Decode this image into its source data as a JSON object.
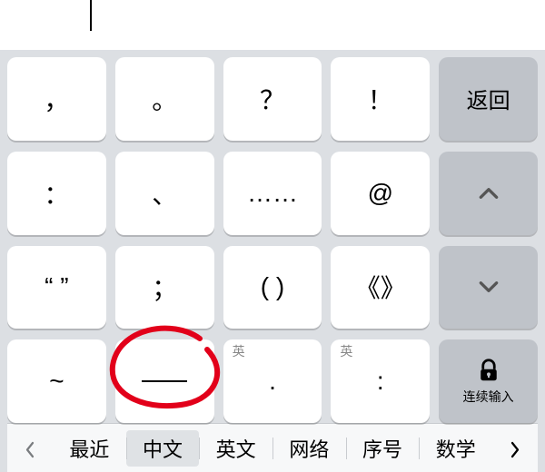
{
  "input": {
    "cursor": true
  },
  "keys": {
    "row1": {
      "k1": "，",
      "k2": "。",
      "k3": "？",
      "k4": "！",
      "side": "返回"
    },
    "row2": {
      "k1": "：",
      "k2": "、",
      "k3": "……",
      "k4": "@"
    },
    "row3": {
      "k1": "“ ”",
      "k2": "；",
      "k3": "( )",
      "k4": "《》"
    },
    "row4": {
      "k1": "~",
      "k3_mini": "英",
      "k3": ".",
      "k4_mini": "英",
      "k4": ":",
      "lock_label": "连续输入"
    }
  },
  "tabs": {
    "items": [
      "最近",
      "中文",
      "英文",
      "网络",
      "序号",
      "数学"
    ],
    "active_index": 1
  },
  "annotation": {
    "circle_color": "#e2001a",
    "target_row": 3,
    "target_col": 1
  }
}
